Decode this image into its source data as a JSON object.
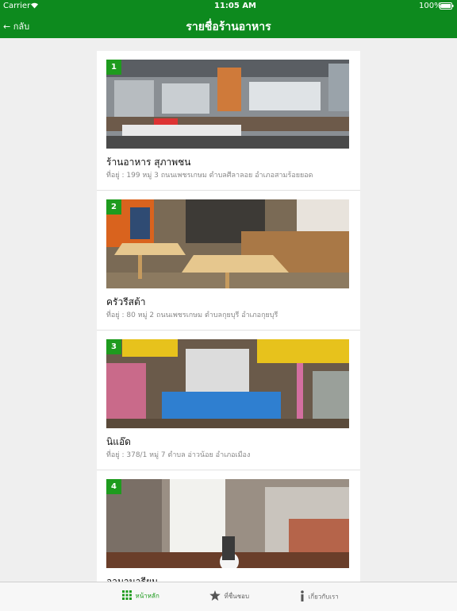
{
  "status": {
    "carrier": "Carrier",
    "time": "11:05 AM",
    "battery": "100%"
  },
  "nav": {
    "back_label": "กลับ",
    "title": "รายชื่อร้านอาหาร"
  },
  "restaurants": [
    {
      "index": "1",
      "name": "ร้านอาหาร สุภาพชน",
      "address": "ที่อยู่ : 199 หมู่ 3 ถนนเพชรเกษม ตำบลศีลาลอย อำเภอสามร้อยยอด"
    },
    {
      "index": "2",
      "name": "ครัวรีสต้า",
      "address": "ที่อยู่ : 80 หมู่ 2 ถนนเพชรเกษม ตำบลกุยบุรี อำเภอกุยบุรี"
    },
    {
      "index": "3",
      "name": "นิแอ๊ด",
      "address": "ที่อยู่ : 378/1 หมู่ 7 ตำบล อ่าวน้อย อำเภอเมือง"
    },
    {
      "index": "4",
      "name": "อามานารียน",
      "address": ""
    }
  ],
  "tabs": [
    {
      "label": "หน้าหลัก",
      "icon": "grid-icon",
      "active": true
    },
    {
      "label": "ที่ชื่นชอบ",
      "icon": "star-icon",
      "active": false
    },
    {
      "label": "เกี่ยวกับเรา",
      "icon": "info-icon",
      "active": false
    }
  ],
  "colors": {
    "brand": "#0d8a1e",
    "badge": "#1e9b1e"
  }
}
